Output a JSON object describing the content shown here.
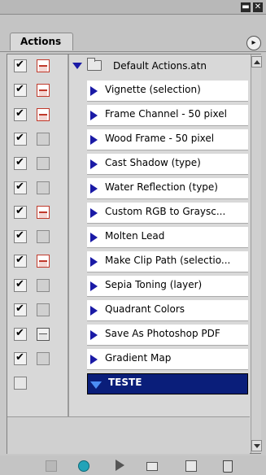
{
  "window": {
    "minimize_glyph": "▬",
    "close_glyph": "✕"
  },
  "panel": {
    "tab_label": "Actions",
    "menu_glyph": "▸"
  },
  "set": {
    "name": "Default Actions.atn",
    "checked": true,
    "dialog": "red"
  },
  "actions": [
    {
      "label": "Vignette (selection)",
      "checked": true,
      "dialog": "red"
    },
    {
      "label": "Frame Channel - 50 pixel",
      "checked": true,
      "dialog": "red"
    },
    {
      "label": "Wood Frame - 50 pixel",
      "checked": true,
      "dialog": "none"
    },
    {
      "label": "Cast Shadow (type)",
      "checked": true,
      "dialog": "none"
    },
    {
      "label": "Water Reflection (type)",
      "checked": true,
      "dialog": "none"
    },
    {
      "label": "Custom RGB to Graysc...",
      "checked": true,
      "dialog": "red"
    },
    {
      "label": "Molten Lead",
      "checked": true,
      "dialog": "none"
    },
    {
      "label": "Make Clip Path (selectio...",
      "checked": true,
      "dialog": "red"
    },
    {
      "label": "Sepia Toning (layer)",
      "checked": true,
      "dialog": "none"
    },
    {
      "label": "Quadrant Colors",
      "checked": true,
      "dialog": "none"
    },
    {
      "label": "Save As Photoshop PDF",
      "checked": true,
      "dialog": "gray"
    },
    {
      "label": "Gradient Map",
      "checked": true,
      "dialog": "none"
    }
  ],
  "selected_set": {
    "name": "TESTE",
    "checked": false
  },
  "toolbar": [
    "stop-icon",
    "record-icon",
    "play-icon",
    "new-set-icon",
    "new-action-icon",
    "delete-icon"
  ],
  "colors": {
    "selection": "#0a1e7a",
    "disclosure": "#1a1aa6",
    "record": "#22a3b8"
  }
}
